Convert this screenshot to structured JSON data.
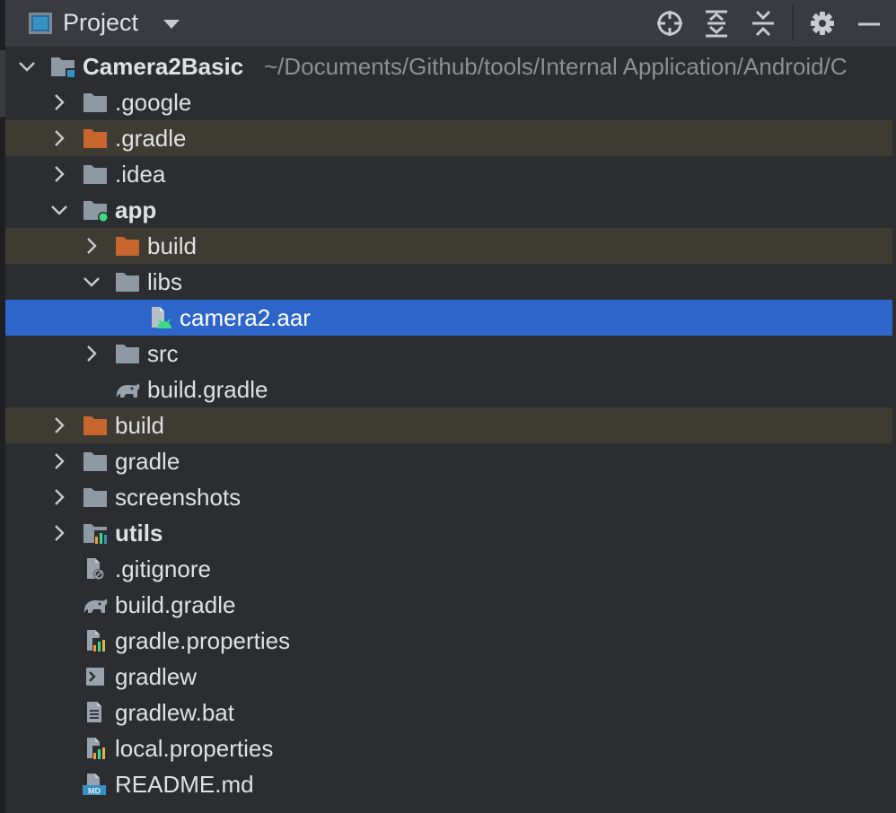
{
  "header": {
    "title": "Project",
    "toolbar_icons": [
      "locate-icon",
      "expand-all-icon",
      "collapse-all-icon",
      "gear-icon",
      "minimize-icon"
    ]
  },
  "tree": {
    "root": {
      "label": "Camera2Basic",
      "path": "~/Documents/Github/tools/Internal Application/Android/C"
    },
    "items": [
      {
        "label": ".google",
        "icon": "folder-icon"
      },
      {
        "label": ".gradle",
        "icon": "excluded-folder-icon"
      },
      {
        "label": ".idea",
        "icon": "folder-icon"
      },
      {
        "label": "app",
        "icon": "module-folder-icon"
      },
      {
        "label": "build",
        "icon": "excluded-folder-icon"
      },
      {
        "label": "libs",
        "icon": "folder-icon"
      },
      {
        "label": "camera2.aar",
        "icon": "android-archive-icon"
      },
      {
        "label": "src",
        "icon": "folder-icon"
      },
      {
        "label": "build.gradle",
        "icon": "gradle-elephant-icon"
      },
      {
        "label": "build",
        "icon": "excluded-folder-icon"
      },
      {
        "label": "gradle",
        "icon": "folder-icon"
      },
      {
        "label": "screenshots",
        "icon": "folder-icon"
      },
      {
        "label": "utils",
        "icon": "module-chart-folder-icon"
      },
      {
        "label": ".gitignore",
        "icon": "gitignore-file-icon"
      },
      {
        "label": "build.gradle",
        "icon": "gradle-elephant-icon"
      },
      {
        "label": "gradle.properties",
        "icon": "properties-file-icon"
      },
      {
        "label": "gradlew",
        "icon": "shell-script-icon"
      },
      {
        "label": "gradlew.bat",
        "icon": "text-file-icon"
      },
      {
        "label": "local.properties",
        "icon": "properties-file-icon"
      },
      {
        "label": "README.md",
        "icon": "markdown-file-icon"
      }
    ]
  },
  "colors": {
    "background": "#2b2d30",
    "header_bg": "#393b40",
    "selection": "#2e65ca",
    "excluded_row": "#3d3b32",
    "excluded_folder": "#c8652f",
    "folder": "#8e99a4",
    "android_green": "#3ddc84"
  }
}
